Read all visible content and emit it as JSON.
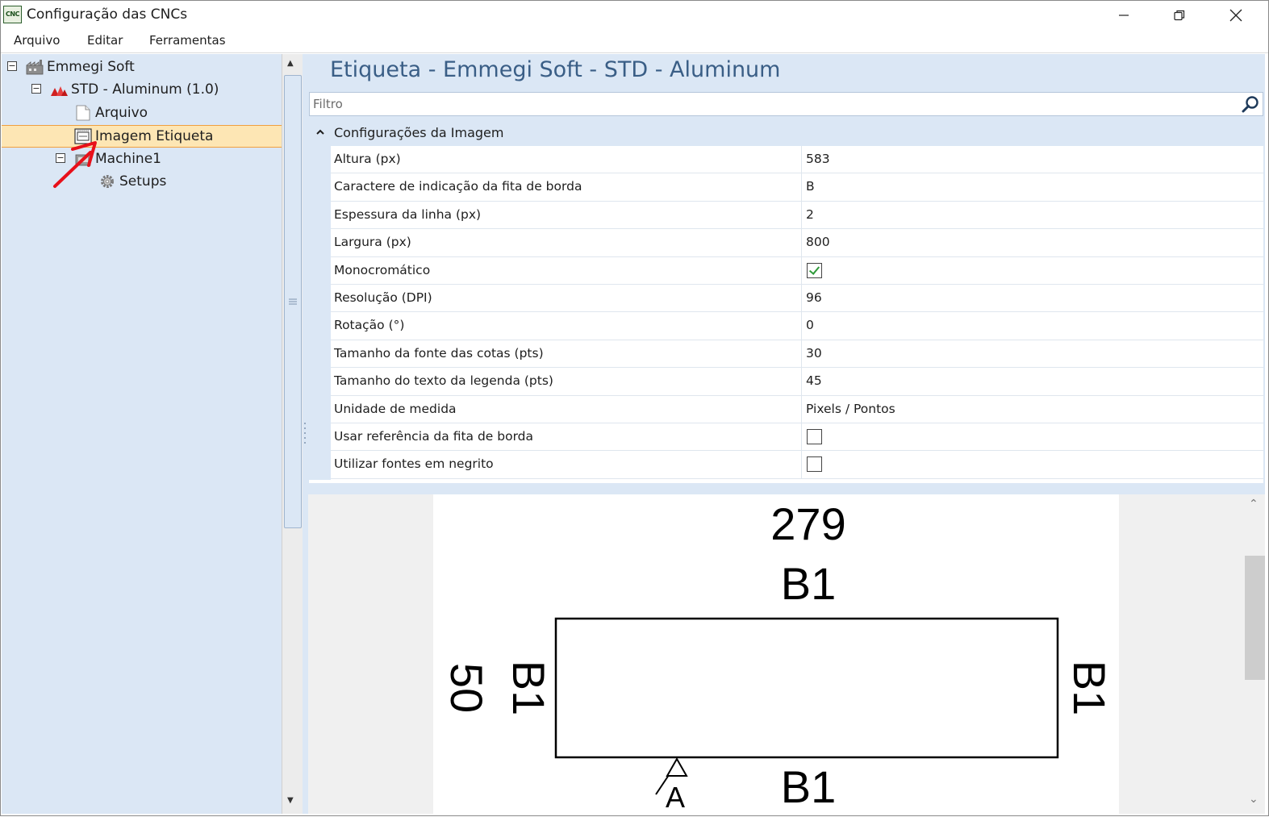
{
  "window": {
    "title": "Configuração das CNCs",
    "icon_text": "CNC",
    "controls": [
      "minimize-icon",
      "restore-icon",
      "close-icon"
    ]
  },
  "menu": {
    "items": [
      "Arquivo",
      "Editar",
      "Ferramentas"
    ]
  },
  "tree": {
    "nodes": [
      {
        "label": "Emmegi Soft",
        "icon": "factory-icon",
        "expander": "⊟"
      },
      {
        "label": "STD - Aluminum (1.0)",
        "icon": "profile-icon",
        "expander": "⊟"
      },
      {
        "label": "Arquivo",
        "icon": "file-icon"
      },
      {
        "label": "Imagem Etiqueta",
        "icon": "label-image-icon",
        "selected": true
      },
      {
        "label": "Machine1",
        "icon": "machine-icon",
        "expander": "⊟"
      },
      {
        "label": "Setups",
        "icon": "gear-icon"
      }
    ],
    "selection_color": "#fde6b4"
  },
  "pane": {
    "title": "Etiqueta - Emmegi Soft - STD - Aluminum",
    "filter_placeholder": "Filtro"
  },
  "grid": {
    "group": "Configurações da Imagem",
    "rows": [
      {
        "name": "Altura (px)",
        "value": "583"
      },
      {
        "name": "Caractere de indicação da fita de borda",
        "value": "B"
      },
      {
        "name": "Espessura da linha (px)",
        "value": "2"
      },
      {
        "name": "Largura (px)",
        "value": "800"
      },
      {
        "name": "Monocromático",
        "checked": true
      },
      {
        "name": "Resolução (DPI)",
        "value": "96"
      },
      {
        "name": "Rotação (°)",
        "value": "0"
      },
      {
        "name": "Tamanho da fonte das cotas (pts)",
        "value": "30"
      },
      {
        "name": "Tamanho do texto da legenda (pts)",
        "value": "45"
      },
      {
        "name": "Unidade de medida",
        "value": "Pixels / Pontos"
      },
      {
        "name": "Usar referência da fita de borda",
        "checked": false
      },
      {
        "name": "Utilizar fontes em negrito",
        "checked": false
      }
    ]
  },
  "preview": {
    "width_dim": "279",
    "height_dim": "50",
    "edge_top": "B1",
    "edge_bottom": "B1",
    "edge_left": "B1",
    "edge_right": "B1",
    "reference_mark": "A"
  },
  "colors": {
    "panel_bg": "#dbe7f5",
    "title_accent": "#3a5e86",
    "check_green": "#2f9a3a",
    "annotation_arrow": "#e8101a"
  }
}
